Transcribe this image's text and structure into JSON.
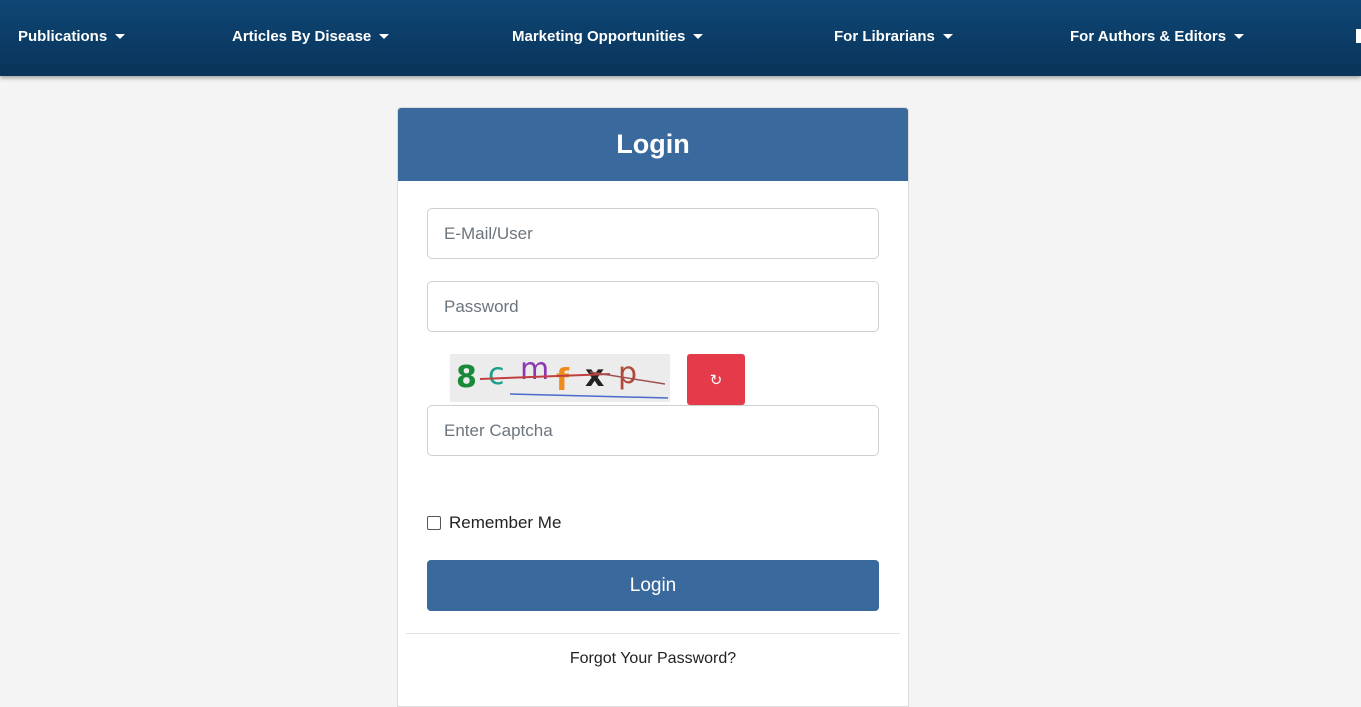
{
  "nav": {
    "items": [
      {
        "label": "Publications"
      },
      {
        "label": "Articles By Disease"
      },
      {
        "label": "Marketing Opportunities"
      },
      {
        "label": "For Librarians"
      },
      {
        "label": "For Authors & Editors"
      }
    ]
  },
  "login": {
    "title": "Login",
    "email_placeholder": "E-Mail/User",
    "password_placeholder": "Password",
    "captcha_text": "8cmfxp",
    "captcha_placeholder": "Enter Captcha",
    "refresh_icon": "refresh-icon",
    "remember_label": "Remember Me",
    "submit_label": "Login",
    "forgot_label": "Forgot Your Password?"
  },
  "colors": {
    "nav_bg": "#0b3c66",
    "primary": "#3a6a9d",
    "refresh_button": "#e43a4a",
    "page_bg": "#f4f4f4"
  }
}
